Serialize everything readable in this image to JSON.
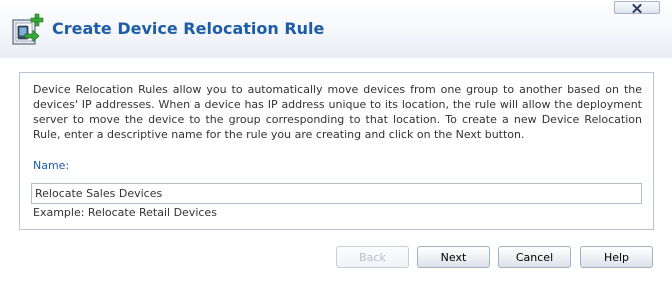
{
  "dialog": {
    "title": "Create Device Relocation Rule",
    "icon": "device-relocation-add-icon",
    "close_icon": "close-icon"
  },
  "content": {
    "description": "Device Relocation Rules allow you to automatically move devices from one group to another based on the devices' IP addresses. When a device has IP address unique to its location, the rule will allow the deployment server to move the device to the group corresponding to that location. To create a new Device Relocation Rule, enter a descriptive name for the rule you are creating and click on the Next button.",
    "name_label": "Name:",
    "name_value": "Relocate Sales Devices",
    "example_text": "Example: Relocate Retail Devices"
  },
  "buttons": {
    "back": "Back",
    "next": "Next",
    "cancel": "Cancel",
    "help": "Help"
  },
  "colors": {
    "title": "#1d5da8",
    "label": "#1d5da8",
    "text": "#333333",
    "disabled_text": "#b8bec8",
    "panel_border": "#b9c3d2"
  }
}
